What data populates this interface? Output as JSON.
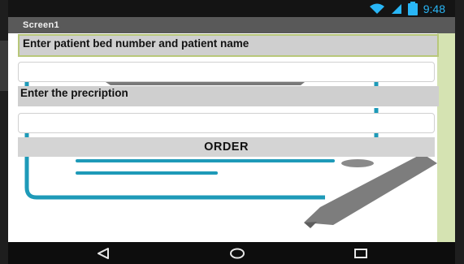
{
  "status_bar": {
    "time": "9:48",
    "icons": [
      "wifi-icon",
      "signal-icon",
      "battery-icon"
    ],
    "icon_color": "#29b6f6"
  },
  "title_bar": {
    "title": "Screen1"
  },
  "form": {
    "patient_label": "Enter patient bed number and patient name",
    "patient_input_value": "",
    "prescription_label": "Enter the precription",
    "prescription_input_value": "",
    "order_button_label": "ORDER"
  },
  "navigation": {
    "buttons": [
      "back-icon",
      "home-icon",
      "recent-apps-icon"
    ]
  },
  "colors": {
    "illustration_accent": "#1e9ab8",
    "label_background": "#cfcfcf",
    "label_border": "#b8c77a",
    "side_strip": "#d5e3b2"
  }
}
